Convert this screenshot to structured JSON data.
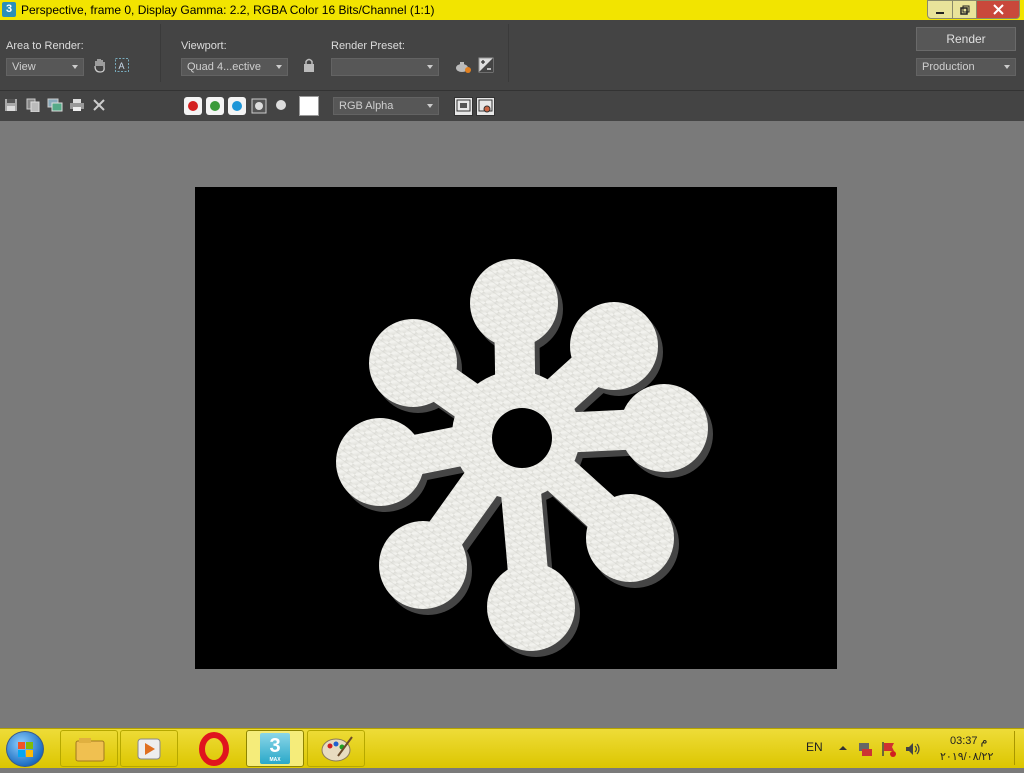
{
  "window": {
    "title": "Perspective, frame 0, Display Gamma: 2.2, RGBA Color 16 Bits/Channel (1:1)",
    "app_icon_label": "3"
  },
  "toolbar": {
    "area_label": "Area to Render:",
    "area_value": "View",
    "viewport_label": "Viewport:",
    "viewport_value": "Quad 4...ective",
    "preset_label": "Render Preset:",
    "preset_value": "",
    "render_button": "Render",
    "mode_value": "Production"
  },
  "channel_toolbar": {
    "channel_value": "RGB Alpha",
    "colors": {
      "red": "#d42020",
      "green": "#3a9a3a",
      "blue": "#1e96d8"
    }
  },
  "taskbar": {
    "max_label": "3",
    "max_sublabel": "MAX",
    "language": "EN",
    "time": "03:37 م",
    "date": "٢٠١٩/٠٨/٢٢"
  }
}
